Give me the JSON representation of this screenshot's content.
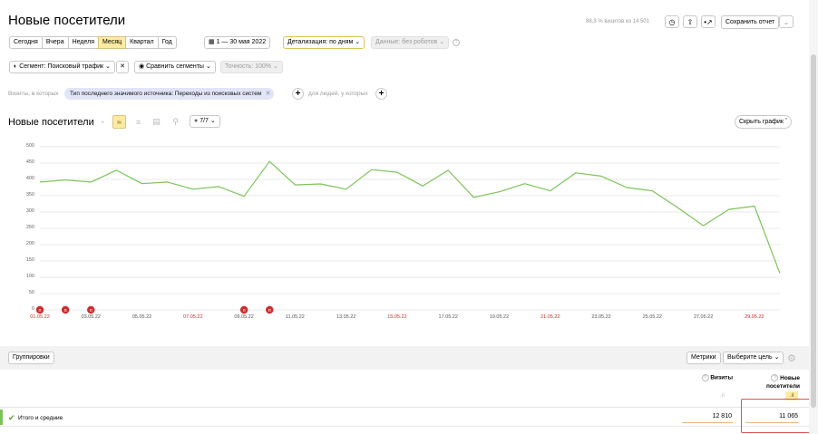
{
  "header": {
    "title": "Новые посетители",
    "sampling_text": "88,3 % визитов из 14 501",
    "save_report": "Сохранить отчет"
  },
  "periods": [
    "Сегодня",
    "Вчера",
    "Неделя",
    "Месяц",
    "Квартал",
    "Год"
  ],
  "active_period": "Месяц",
  "date_range": "1 — 30 мая 2022",
  "detail": "Детализация: по дням",
  "data_filter": "Данные: без роботов",
  "segment": {
    "label": "Сегмент: Поисковый трафик",
    "compare": "Сравнить сегменты",
    "accuracy": "Точность: 100%"
  },
  "filters": {
    "visits_label": "Визиты, в которых",
    "chip": "Тип последнего значимого источника: Переходы из поисковых систем",
    "people_label": "для людей, у которых"
  },
  "chart_toolbar": {
    "title": "Новые посетители",
    "series_count": "7/7",
    "hide_chart": "Скрыть график"
  },
  "chart_data": {
    "type": "line",
    "title": "",
    "xlabel": "",
    "ylabel": "",
    "ylim": [
      0,
      500
    ],
    "yticks": [
      0,
      50,
      100,
      150,
      200,
      250,
      300,
      350,
      400,
      450,
      500
    ],
    "x_tick_labels": [
      "01.05.22",
      "03.05.22",
      "05.05.22",
      "07.05.22",
      "09.05.22",
      "11.05.22",
      "13.05.22",
      "15.05.22",
      "17.05.22",
      "19.05.22",
      "21.05.22",
      "23.05.22",
      "25.05.22",
      "27.05.22",
      "29.05.22"
    ],
    "red_x_labels": [
      "01.05.22",
      "07.05.22",
      "15.05.22",
      "21.05.22",
      "29.05.22"
    ],
    "holiday_markers": [
      "01.05.22",
      "02.05.22",
      "03.05.22",
      "09.05.22",
      "10.05.22"
    ],
    "holiday_marker_label": "п",
    "series": [
      {
        "color": "#7cc35a",
        "values": [
          392,
          398,
          392,
          428,
          387,
          392,
          370,
          378,
          348,
          455,
          383,
          386,
          370,
          430,
          422,
          380,
          428,
          345,
          362,
          387,
          365,
          420,
          410,
          375,
          365,
          313,
          258,
          308,
          318,
          112
        ]
      }
    ]
  },
  "table": {
    "groupings_button": "Группировки",
    "metrics_button": "Метрики",
    "goal_button": "Выберите цель",
    "columns": [
      "Визиты",
      "Новые посетители"
    ],
    "total_label": "Итого и средние",
    "total_values": [
      "12 810",
      "11 065"
    ]
  },
  "colors": {
    "accent": "#ffeba0",
    "line": "#7cc35a",
    "holiday": "#d12b2b",
    "highlight_box": "#d9534f"
  }
}
